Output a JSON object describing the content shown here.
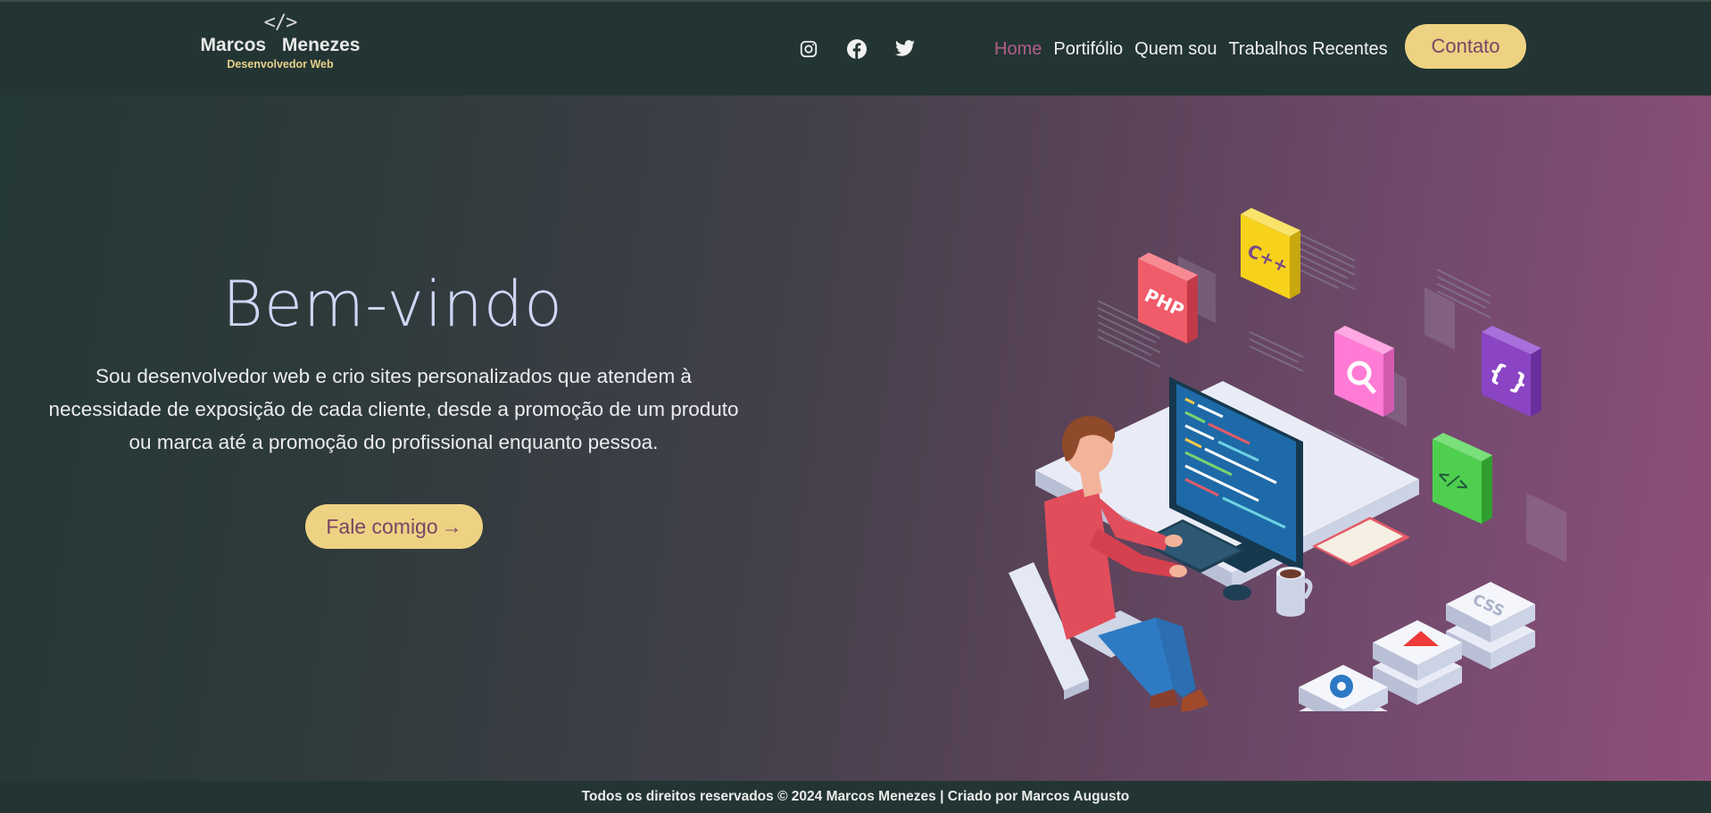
{
  "logo": {
    "icon": "</>",
    "name": "Marcos Menezes",
    "subtitle": "Desenvolvedor Web"
  },
  "social": [
    {
      "name": "instagram-icon"
    },
    {
      "name": "facebook-icon"
    },
    {
      "name": "twitter-icon"
    }
  ],
  "nav": {
    "items": [
      {
        "label": "Home",
        "active": true
      },
      {
        "label": "Portifólio",
        "active": false
      },
      {
        "label": "Quem sou",
        "active": false
      },
      {
        "label": "Trabalhos Recentes",
        "active": false
      }
    ],
    "contact_label": "Contato"
  },
  "hero": {
    "title": "Bem-vindo",
    "text": "Sou desenvolvedor web e crio sites personalizados que atendem à necessidade de exposição de cada cliente, desde a promoção de um produto ou marca até a promoção do profissional enquanto pessoa.",
    "cta_label": "Fale comigo",
    "cta_arrow": "→",
    "illustration": {
      "tiles": [
        "PHP",
        "C++",
        "{ }",
        "</>",
        "CSS"
      ]
    }
  },
  "footer": {
    "text": "Todos os direitos reservados © 2024 Marcos Menezes | Criado por Marcos Augusto"
  },
  "colors": {
    "header_bg": "#233533",
    "accent_yellow": "#eed283",
    "accent_text": "#7b4466",
    "active_link": "#b15d8a"
  }
}
